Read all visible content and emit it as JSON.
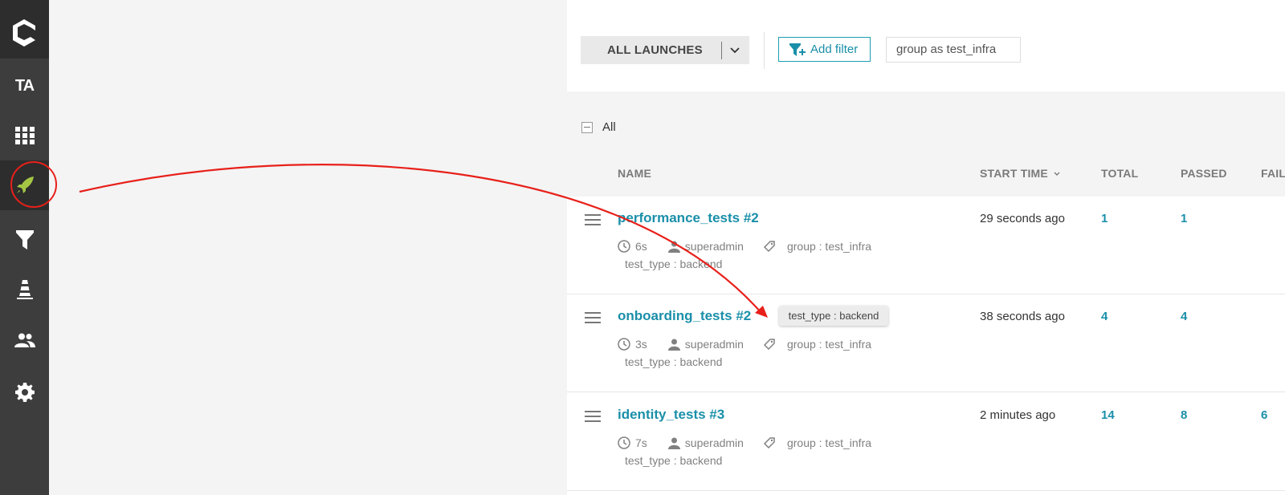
{
  "sidebar": {
    "project_initials": "TA",
    "items": [
      {
        "icon": "dashboard-grid-icon"
      },
      {
        "icon": "rocket-icon",
        "active": true
      },
      {
        "icon": "filter-icon"
      },
      {
        "icon": "debug-cone-icon"
      },
      {
        "icon": "members-icon"
      },
      {
        "icon": "settings-gear-icon"
      }
    ]
  },
  "toolbar": {
    "launches_select": "ALL LAUNCHES",
    "add_filter": "Add filter",
    "filter_chip": "group as test_infra"
  },
  "table": {
    "select_all_label": "All",
    "headers": {
      "name": "NAME",
      "start_time": "START TIME",
      "total": "TOTAL",
      "passed": "PASSED",
      "failed": "FAIL"
    },
    "rows": [
      {
        "name": "performance_tests #2",
        "duration": "6s",
        "owner": "superadmin",
        "attr1": "group : test_infra",
        "attr2": "test_type : backend",
        "start_time": "29 seconds ago",
        "total": "1",
        "passed": "1",
        "failed": ""
      },
      {
        "name": "onboarding_tests #2",
        "duration": "3s",
        "owner": "superadmin",
        "attr1": "group : test_infra",
        "attr2": "test_type : backend",
        "start_time": "38 seconds ago",
        "total": "4",
        "passed": "4",
        "failed": ""
      },
      {
        "name": "identity_tests #3",
        "duration": "7s",
        "owner": "superadmin",
        "attr1": "group : test_infra",
        "attr2": "test_type : backend",
        "start_time": "2 minutes ago",
        "total": "14",
        "passed": "8",
        "failed": "6"
      }
    ]
  },
  "tooltip": "test_type : backend",
  "colors": {
    "accent": "#1a8fa9",
    "sidebar": "#3d3d3d",
    "active_icon": "#a3c644",
    "annotation": "#e8201a"
  }
}
